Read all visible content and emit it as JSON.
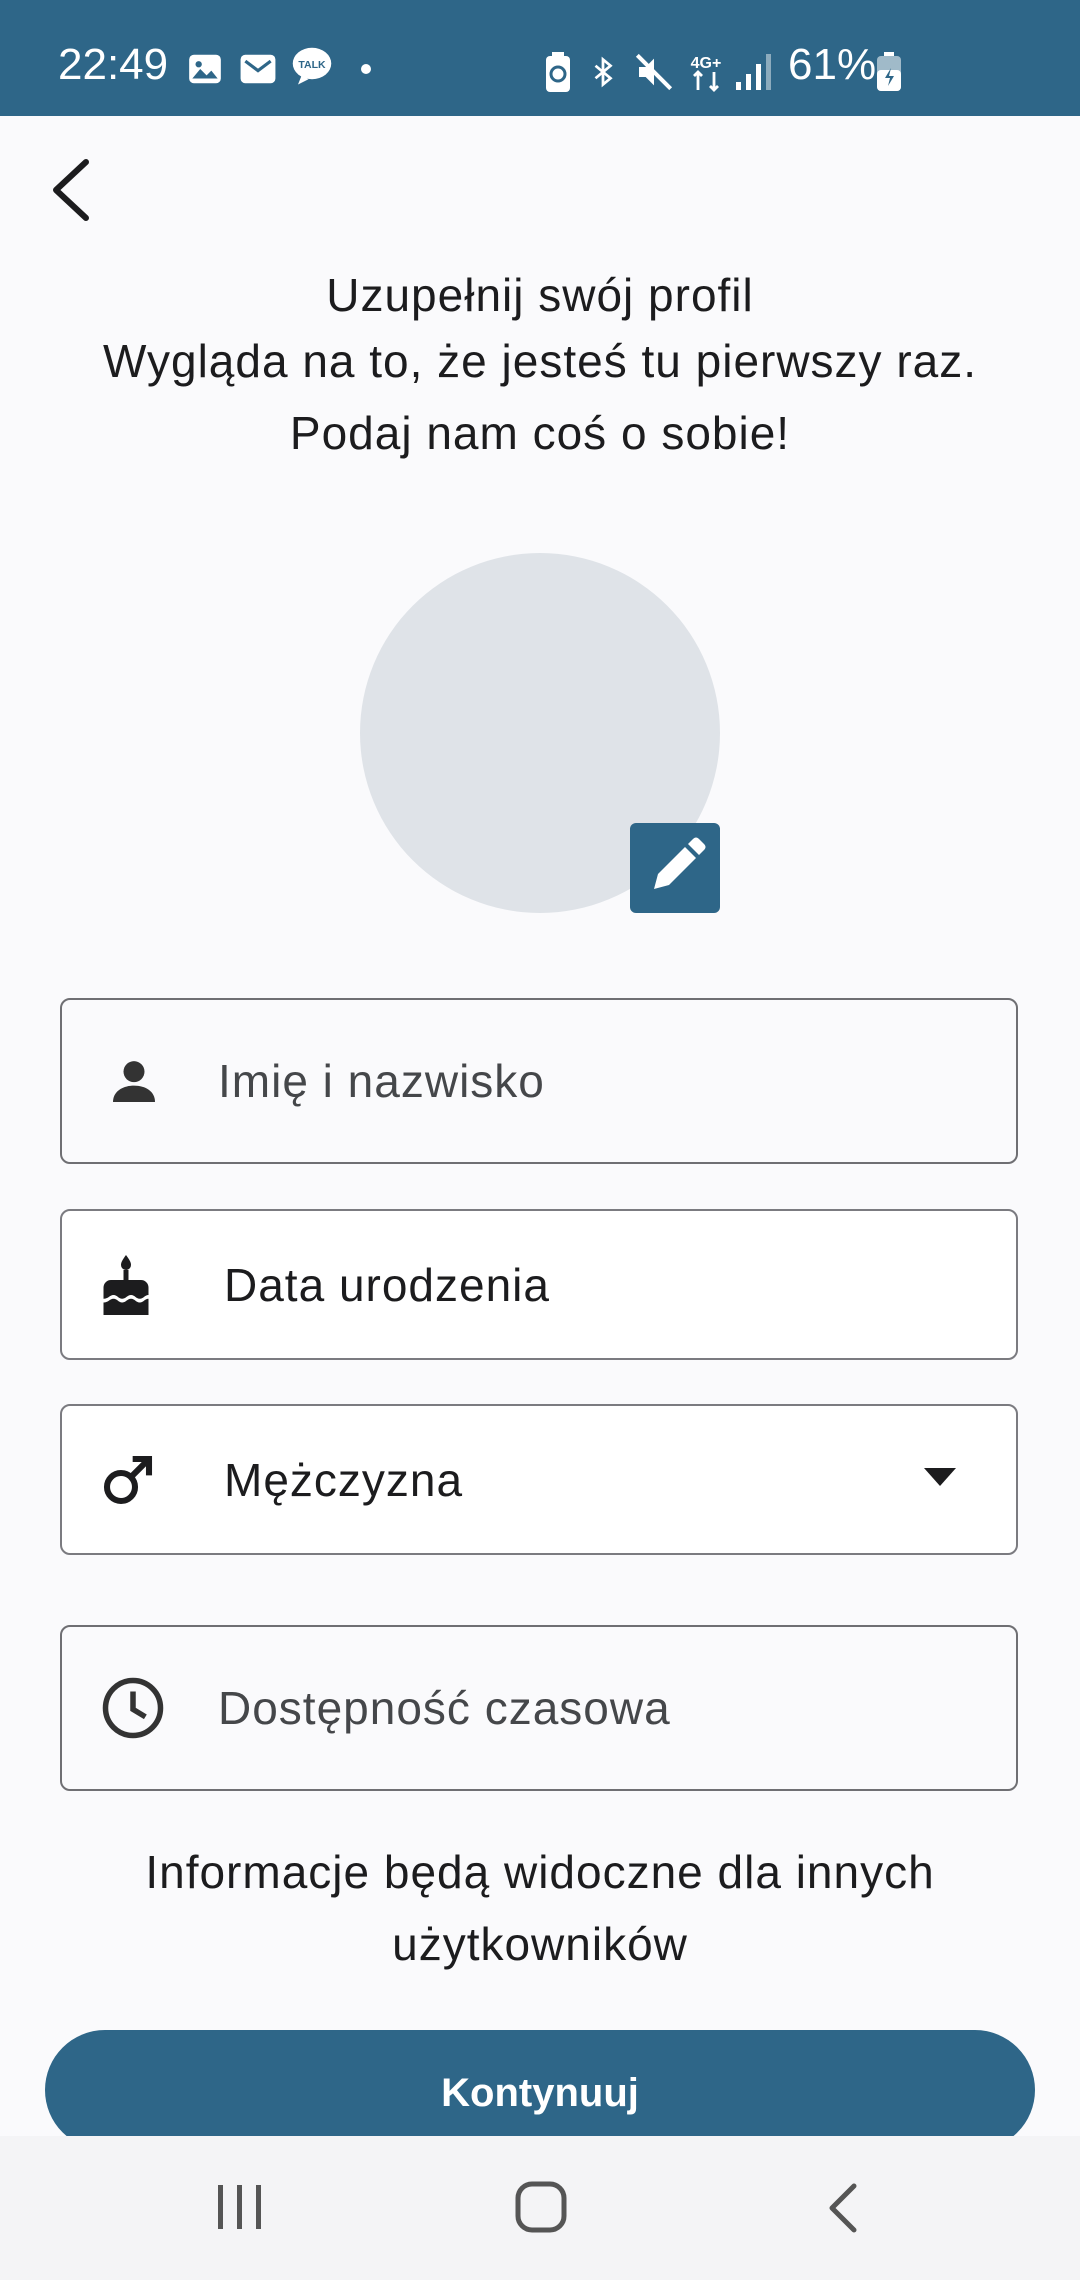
{
  "status_bar": {
    "time": "22:49",
    "battery": "61%",
    "icons": [
      "gallery-icon",
      "mail-icon",
      "talk-icon",
      "dot-icon",
      "battery-saver-icon",
      "bluetooth-icon",
      "mute-icon",
      "4g-icon",
      "signal-icon",
      "battery-icon"
    ]
  },
  "header": {
    "line1": "Uzupełnij swój profil",
    "line2": "Wygląda na to, że jesteś tu pierwszy raz.",
    "line3": "Podaj nam coś o sobie!"
  },
  "form": {
    "name": {
      "placeholder": "Imię i nazwisko",
      "icon": "person-icon"
    },
    "birthdate": {
      "label": "Data urodzenia",
      "icon": "cake-icon"
    },
    "gender": {
      "value": "Mężczyzna",
      "icon": "male-icon"
    },
    "availability": {
      "placeholder": "Dostępność czasowa",
      "icon": "clock-icon"
    }
  },
  "info_text": {
    "line1": "Informacje będą widoczne dla innych",
    "line2": "użytkowników"
  },
  "continue_button": "Kontynuuj",
  "colors": {
    "primary": "#2e6688",
    "background": "#fafafc",
    "avatar": "#dfe3e8"
  }
}
